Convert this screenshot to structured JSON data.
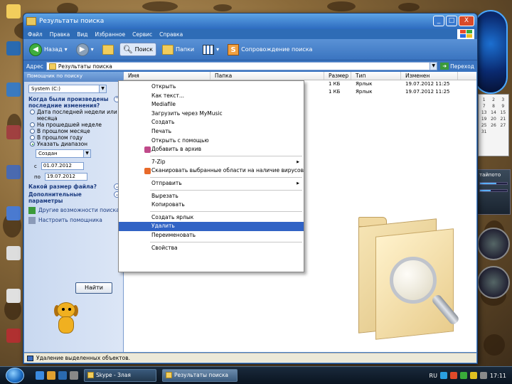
{
  "window": {
    "title": "Результаты поиска",
    "controls": {
      "minimize": "_",
      "maximize": "□",
      "close": "X"
    }
  },
  "menu": [
    "Файл",
    "Правка",
    "Вид",
    "Избранное",
    "Сервис",
    "Справка"
  ],
  "toolbar": {
    "back": "Назад",
    "search": "Поиск",
    "folders": "Папки",
    "search_companion": "Сопровождение поиска"
  },
  "address": {
    "label": "Адрес",
    "value": "Результаты поиска",
    "go": "Переход"
  },
  "search_pane": {
    "title": "Помощник по поиску",
    "drive": "System (C:)",
    "when_heading": "Когда были произведены последние изменения?",
    "options": [
      "Дата последней недели или месяца",
      "На прошедшей неделе",
      "В прошлом месяце",
      "В прошлом году",
      "Указать диапазон"
    ],
    "range_type": "Создан",
    "from_label": "с",
    "from_date": "01.07.2012",
    "to_label": "по",
    "to_date": "19.07.2012",
    "size_heading": "Какой размер файла?",
    "advanced_heading": "Дополнительные параметры",
    "other_link": "Другие возможности поиска",
    "settings_link": "Настроить помощника",
    "find_button": "Найти"
  },
  "results": {
    "columns": [
      "Имя",
      "Папка",
      "Размер",
      "Тип",
      "Изменен"
    ],
    "rows": [
      {
        "name": "Новая папка",
        "folder": "C:\\Documents and Settings\\Adel",
        "size": "1 КБ",
        "type": "Ярлык",
        "modified": "19.07.2012 11:25"
      },
      {
        "name": "Новая папка",
        "folder": "C:\\Documents and Settings\\Adel",
        "size": "1 КБ",
        "type": "Ярлык",
        "modified": "19.07.2012 11:25"
      }
    ]
  },
  "context_menu": [
    {
      "label": "Открыть"
    },
    {
      "label": "Как текст..."
    },
    {
      "label": "Mediafile"
    },
    {
      "label": "Загрузить через MyMusic"
    },
    {
      "label": "Создать"
    },
    {
      "label": "Печать"
    },
    {
      "label": "Открыть с помощью"
    },
    {
      "label": "Добавить в архив",
      "icon": true
    },
    {
      "separator": true
    },
    {
      "label": "7-Zip",
      "submenu": true
    },
    {
      "label": "Сканировать выбранные области на наличие вирусов",
      "icon": true
    },
    {
      "separator": true
    },
    {
      "label": "Отправить",
      "submenu": true
    },
    {
      "separator": true
    },
    {
      "label": "Вырезать"
    },
    {
      "label": "Копировать"
    },
    {
      "separator": true
    },
    {
      "label": "Создать ярлык"
    },
    {
      "label": "Удалить",
      "highlighted": true
    },
    {
      "label": "Переименовать"
    },
    {
      "separator": true
    },
    {
      "label": "Свойства"
    }
  ],
  "status": "Удаление выделенных объектов.",
  "taskbar": {
    "tasks": [
      "Skype - Злая",
      "Результаты поиска"
    ],
    "lang": "RU",
    "clock": "17:11"
  },
  "calendar": {
    "rows": [
      [
        "1",
        "2",
        "3"
      ],
      [
        "7",
        "8",
        "9"
      ],
      [
        "13",
        "14",
        "15"
      ],
      [
        "19",
        "20",
        "21"
      ],
      [
        "25",
        "26",
        "27"
      ],
      [
        "31",
        "",
        ""
      ]
    ]
  },
  "gadget": {
    "title": "тайпото"
  }
}
